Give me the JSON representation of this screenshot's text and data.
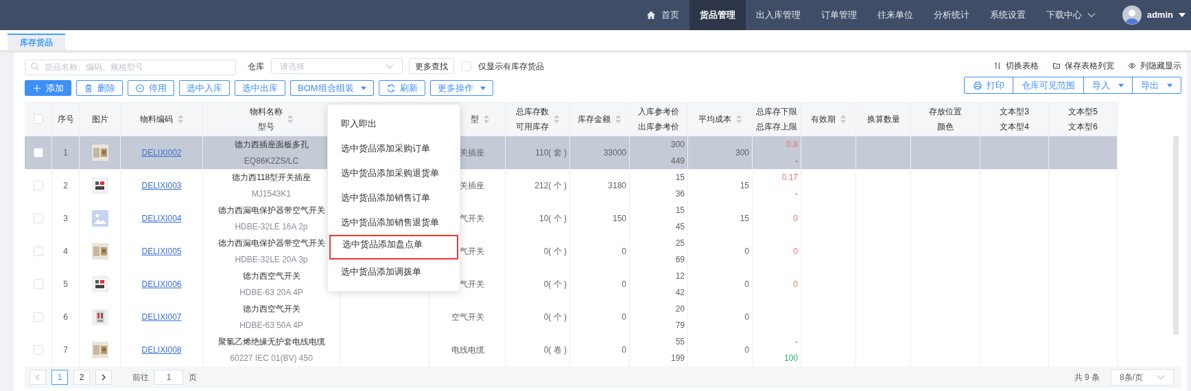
{
  "nav": {
    "items": [
      {
        "label": "首页",
        "selected": false,
        "dropdown": false
      },
      {
        "label": "货品管理",
        "selected": true,
        "dropdown": false
      },
      {
        "label": "出入库管理",
        "selected": false,
        "dropdown": false
      },
      {
        "label": "订单管理",
        "selected": false,
        "dropdown": false
      },
      {
        "label": "往来单位",
        "selected": false,
        "dropdown": false
      },
      {
        "label": "分析统计",
        "selected": false,
        "dropdown": false
      },
      {
        "label": "系统设置",
        "selected": false,
        "dropdown": false
      },
      {
        "label": "下载中心",
        "selected": false,
        "dropdown": true
      }
    ],
    "user": "admin"
  },
  "tabs": [
    {
      "label": "库存货品",
      "selected": true
    }
  ],
  "filters": {
    "search_placeholder": "货品名称、编码、规格型号",
    "warehouse_label": "仓库",
    "warehouse_placeholder": "请选择",
    "more_search": "更多查找",
    "stock_only": {
      "label": "仅显示有库存货品",
      "checked": false
    }
  },
  "view_links": [
    {
      "label": "切换表格"
    },
    {
      "label": "保存表格列宽"
    },
    {
      "label": "列隐藏显示"
    }
  ],
  "toolbar": [
    {
      "label": "添加",
      "kind": "primary",
      "caret": false
    },
    {
      "label": "删除",
      "kind": "plain",
      "caret": false
    },
    {
      "label": "停用",
      "kind": "plain",
      "caret": false
    },
    {
      "label": "选中入库",
      "kind": "plain",
      "caret": false
    },
    {
      "label": "选中出库",
      "kind": "plain",
      "caret": false
    },
    {
      "label": "BOM组合组装",
      "kind": "plain",
      "caret": true
    },
    {
      "label": "刷新",
      "kind": "plain",
      "caret": false
    },
    {
      "label": "更多操作",
      "kind": "plain",
      "caret": true
    }
  ],
  "right_toolbar": [
    {
      "label": "打印",
      "caret": false
    },
    {
      "label": "仓库可见范围",
      "caret": false
    },
    {
      "label": "导入",
      "caret": true
    },
    {
      "label": "导出",
      "caret": true
    }
  ],
  "table": {
    "columns": [
      {
        "kind": "checkbox",
        "checked": false
      },
      {
        "kind": "text",
        "lines": [
          "序号"
        ],
        "sortable": false
      },
      {
        "kind": "text",
        "lines": [
          "图片"
        ],
        "sortable": false
      },
      {
        "kind": "text",
        "lines": [
          "物料编码"
        ],
        "sortable": true
      },
      {
        "kind": "text",
        "lines": [
          "物料名称",
          "型号"
        ],
        "sortable": true
      },
      {
        "kind": "text",
        "lines": [
          "型"
        ],
        "sortable": true
      },
      {
        "kind": "text",
        "lines": [
          "总库存数",
          "可用库存"
        ],
        "sortable": true
      },
      {
        "kind": "text",
        "lines": [
          "库存金额"
        ],
        "sortable": true
      },
      {
        "kind": "text",
        "lines": [
          "入库参考价",
          "出库参考价"
        ],
        "sortable": false
      },
      {
        "kind": "text",
        "lines": [
          "平均成本"
        ],
        "sortable": true
      },
      {
        "kind": "text",
        "lines": [
          "总库存下限",
          "总库存上限"
        ],
        "sortable": false
      },
      {
        "kind": "text",
        "lines": [
          "有效期"
        ],
        "sortable": true
      },
      {
        "kind": "text",
        "lines": [
          "换算数量"
        ],
        "sortable": false
      },
      {
        "kind": "text",
        "lines": [
          "存放位置",
          "颜色"
        ],
        "sortable": false
      },
      {
        "kind": "text",
        "lines": [
          "文本型3",
          "文本型4"
        ],
        "sortable": false
      },
      {
        "kind": "text",
        "lines": [
          "文本型5",
          "文本型6"
        ],
        "sortable": false
      }
    ],
    "rows": [
      {
        "selected": true,
        "checked": false,
        "no": "1",
        "code": "DELIXI002",
        "name": "德力西插座面板多孔",
        "model": "EQ86K2ZS/LC",
        "type": "关插座",
        "stock": "110( 套 )",
        "amount": "33000",
        "in_price": "300",
        "out_price": "449",
        "avg_cost": "300",
        "lower": {
          "text": "0.8",
          "color": "#f56c6c"
        },
        "upper": {
          "text": "-"
        }
      },
      {
        "selected": false,
        "checked": false,
        "no": "2",
        "code": "DELIXI003",
        "name": "德力西118型开关插座",
        "model": "MJ1543K1",
        "type": "关插座",
        "stock": "212( 个 )",
        "amount": "3180",
        "in_price": "15",
        "out_price": "36",
        "avg_cost": "15",
        "lower": {
          "text": "0.17",
          "color": "#f56c6c"
        },
        "upper": {
          "text": "-"
        }
      },
      {
        "selected": false,
        "checked": false,
        "no": "3",
        "image": {
          "kind": "placeholder"
        },
        "code": "DELIXI004",
        "name": "德力西漏电保护器带空气开关",
        "model": "HDBE-32LE 16A 2p",
        "type": "气开关",
        "stock": "10( 个 )",
        "amount": "150",
        "in_price": "15",
        "out_price": "45",
        "avg_cost": "15",
        "lower": {
          "text": "0",
          "color": "#f56c6c"
        }
      },
      {
        "selected": false,
        "checked": false,
        "no": "4",
        "code": "DELIXI005",
        "name": "德力西漏电保护器带空气开关",
        "model": "HDBE-32LE 20A 3p",
        "type": "气开关",
        "stock": "0( 个 )",
        "amount": "0",
        "in_price": "25",
        "out_price": "69",
        "avg_cost": "0",
        "lower": {
          "text": "0",
          "color": "#f56c6c"
        }
      },
      {
        "selected": false,
        "checked": false,
        "no": "5",
        "code": "DELIXI006",
        "name": "德力西空气开关",
        "model": "HDBE-63 20A 4P",
        "type": "气开关",
        "stock": "0( 个 )",
        "amount": "0",
        "in_price": "12",
        "out_price": "42",
        "avg_cost": "0",
        "lower": {
          "text": "0",
          "color": "#f56c6c"
        }
      },
      {
        "selected": false,
        "checked": false,
        "no": "6",
        "code": "DELIXI007",
        "name": "德力西空气开关",
        "model": "HDBE-63 50A 4P",
        "type": "空气开关",
        "stock": "0( 个 )",
        "amount": "0",
        "in_price": "20",
        "out_price": "79",
        "avg_cost": "0"
      },
      {
        "selected": false,
        "checked": false,
        "no": "7",
        "code": "DELIXI008",
        "name": "聚氯乙烯绝缘无护套电线电缆",
        "model": "60227 IEC 01(BV) 450",
        "type": "电线电缆",
        "stock": "0( 卷 )",
        "amount": "0",
        "in_price": "55",
        "out_price": "199",
        "avg_cost": "0",
        "lower": {
          "text": "-"
        },
        "upper": {
          "text": "100",
          "color": "#19be6b"
        }
      }
    ]
  },
  "dropdown": {
    "items": [
      {
        "label": "即入即出",
        "highlighted": false
      },
      {
        "label": "选中货品添加采购订单",
        "highlighted": false
      },
      {
        "label": "选中货品添加采购退货单",
        "highlighted": false
      },
      {
        "label": "选中货品添加销售订单",
        "highlighted": false
      },
      {
        "label": "选中货品添加销售退货单",
        "highlighted": false
      },
      {
        "label": "选中货品添加盘点单",
        "highlighted": true
      },
      {
        "label": "选中货品添加调拨单",
        "highlighted": false
      }
    ]
  },
  "pagination": {
    "prev_disabled": true,
    "pages": [
      {
        "label": "1",
        "selected": true
      },
      {
        "label": "2",
        "selected": false
      }
    ],
    "goto_label": "前往",
    "goto_value": "1",
    "page_suffix": "页",
    "total": "共 9 条",
    "page_size": "8条/页"
  }
}
